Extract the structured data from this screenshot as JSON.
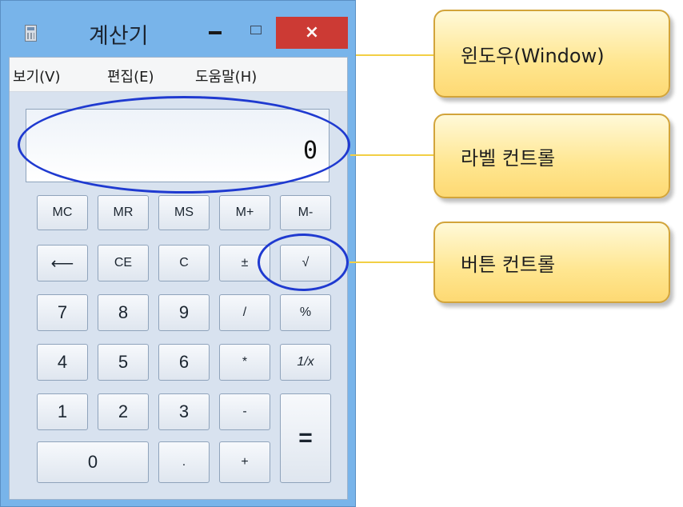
{
  "window": {
    "title": "계산기",
    "close_glyph": "×"
  },
  "menu": [
    {
      "label": "보기(V)"
    },
    {
      "label": "편집(E)"
    },
    {
      "label": "도움말(H)"
    }
  ],
  "display": {
    "value": "0"
  },
  "keys": {
    "mc": "MC",
    "mr": "MR",
    "ms": "MS",
    "mplus": "M+",
    "mminus": "M-",
    "back": "⟵",
    "ce": "CE",
    "c": "C",
    "plusminus": "±",
    "sqrt": "√",
    "k7": "7",
    "k8": "8",
    "k9": "9",
    "div": "/",
    "pct": "%",
    "k4": "4",
    "k5": "5",
    "k6": "6",
    "mul": "*",
    "recip": "1/x",
    "k1": "1",
    "k2": "2",
    "k3": "3",
    "sub": "-",
    "eq": "=",
    "k0": "0",
    "dot": ".",
    "add": "+"
  },
  "annotations": [
    {
      "label": "윈도우(Window)"
    },
    {
      "label": "라벨 컨트롤"
    },
    {
      "label": "버튼 컨트롤"
    }
  ],
  "colors": {
    "window_frame": "#78b4ea",
    "close_button": "#cc3a34",
    "callout_fill": "#ffe690",
    "highlight_ellipse": "#1f3ad0"
  }
}
